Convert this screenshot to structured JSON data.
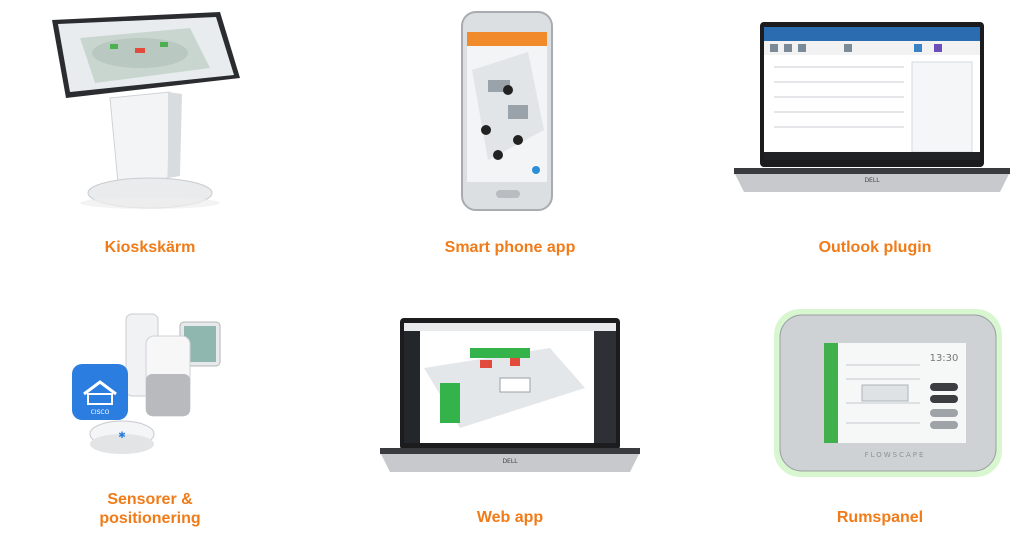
{
  "accent": "#f07b18",
  "products": [
    {
      "label": "Kioskskärm",
      "icon": "kiosk-stand"
    },
    {
      "label": "Smart phone app",
      "icon": "smartphone"
    },
    {
      "label": "Outlook plugin",
      "icon": "laptop-outlook"
    },
    {
      "label": "Sensorer &\npositionering",
      "icon": "sensor-devices"
    },
    {
      "label": "Web app",
      "icon": "laptop-floorplan"
    },
    {
      "label": "Rumspanel",
      "icon": "room-panel"
    }
  ],
  "logos": {
    "sensor_app": "CISCO",
    "panel_brand": "FLOWSCAPE",
    "laptop_brand": "DELL"
  },
  "panel": {
    "time": "13:30"
  }
}
